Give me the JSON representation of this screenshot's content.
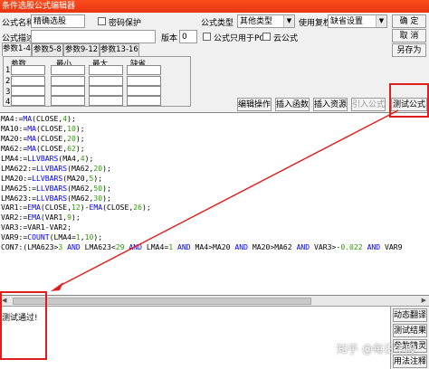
{
  "window": {
    "title": "条件选股公式编辑器"
  },
  "form": {
    "name_label": "公式名称",
    "name_value": "精确选股",
    "password_label": "密码保护",
    "desc_label": "公式描述",
    "desc_value": "",
    "type_label": "公式类型",
    "type_value": "其他类型",
    "rights_label": "使用复权",
    "rights_value": "缺省设置",
    "version_label": "版本",
    "version_value": "0",
    "pc_only_label": "公式只用于PC",
    "cloud_label": "云公式"
  },
  "buttons": {
    "ok": "确 定",
    "cancel": "取 消",
    "save_as": "另存为",
    "edit_ops": "编辑操作",
    "insert_func": "插入函数",
    "insert_resource": "插入资源",
    "import_formula": "引入公式",
    "test_formula": "测试公式"
  },
  "tabs": [
    "参数1-4",
    "参数5-8",
    "参数9-12",
    "参数13-16"
  ],
  "param_table": {
    "headers": [
      "参数",
      "最小",
      "最大",
      "缺省"
    ],
    "rows": [
      "1",
      "2",
      "3",
      "4"
    ]
  },
  "code_lines": [
    "MA4:=MA(CLOSE,4);",
    "MA10:=MA(CLOSE,10);",
    "MA20:=MA(CLOSE,20);",
    "MA62:=MA(CLOSE,62);",
    "LMA4:=LLVBARS(MA4,4);",
    "LMA622:=LLVBARS(MA62,20);",
    "LMA20:=LLVBARS(MA20,5);",
    "LMA625:=LLVBARS(MA62,50);",
    "LMA623:=LLVBARS(MA62,30);",
    "VAR1:=EMA(CLOSE,12)-EMA(CLOSE,26);",
    "VAR2:=EMA(VAR1,9);",
    "VAR3:=VAR1-VAR2;",
    "VAR9:=COUNT(LMA4=1,10);",
    "CON7:(LMA623>3 AND LMA623<29 AND LMA4=1 AND MA4>MA20 AND MA20>MA62 AND VAR3>-0.022 AND VAR9"
  ],
  "output": {
    "message": "测试通过!"
  },
  "side_buttons": [
    "动态翻译",
    "测试结果",
    "参数精灵",
    "用法注释"
  ],
  "watermark": "知乎 @每日学股"
}
